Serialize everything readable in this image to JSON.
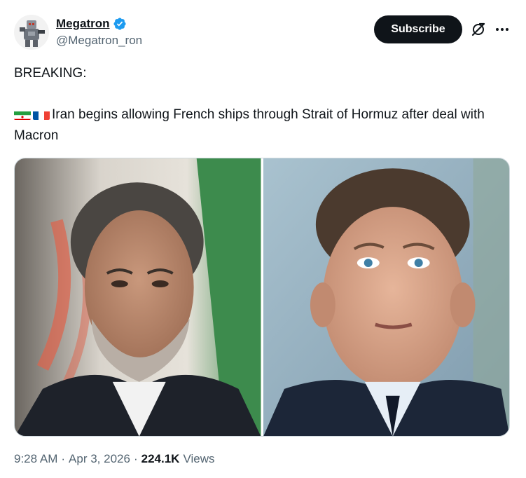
{
  "author": {
    "display_name": "Megatron",
    "handle": "@Megatron_ron",
    "verified": true
  },
  "actions": {
    "subscribe_label": "Subscribe",
    "grok_icon": "grok-icon",
    "more_icon": "more-icon"
  },
  "post": {
    "line1": "BREAKING:",
    "flags": [
      "iran-flag",
      "france-flag"
    ],
    "text": "Iran begins allowing French ships through Strait of Hormuz after deal with Macron"
  },
  "media": {
    "images": [
      "photo-iranian-official",
      "photo-emmanuel-macron"
    ]
  },
  "meta": {
    "time": "9:28 AM",
    "date": "Apr 3, 2026",
    "separator": "·",
    "views_count": "224.1K",
    "views_label": "Views"
  },
  "colors": {
    "text": "#0f1419",
    "secondary": "#536471",
    "verified_blue": "#1d9bf0",
    "button_bg": "#0f1419"
  }
}
